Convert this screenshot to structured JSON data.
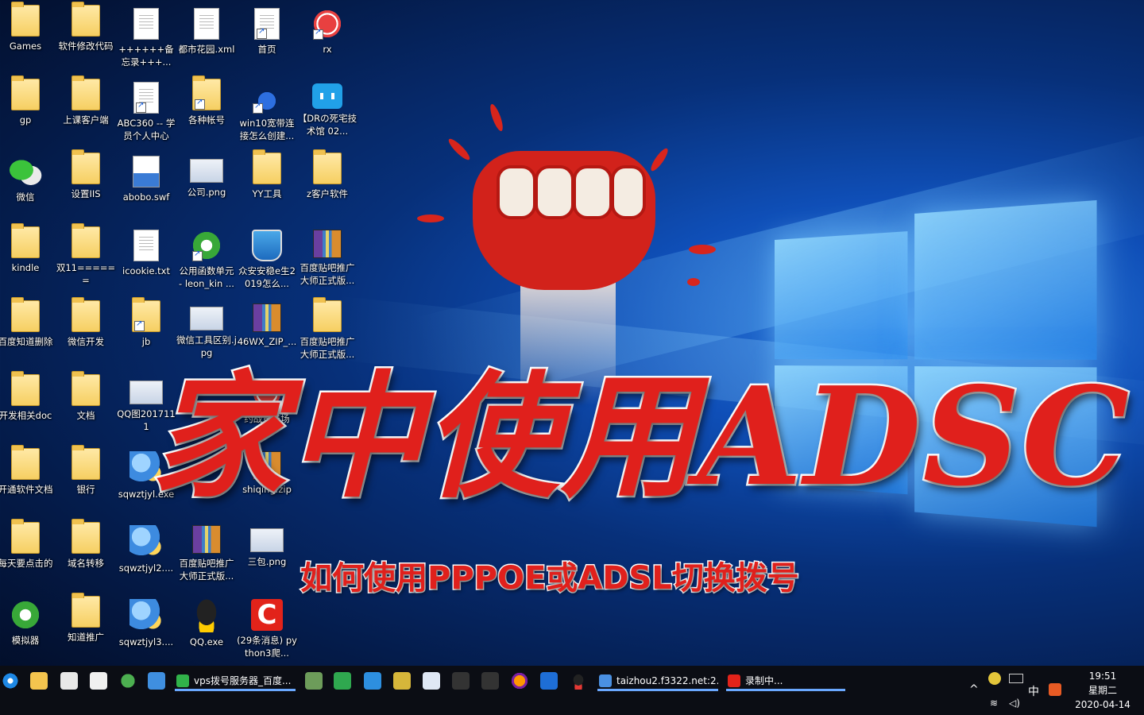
{
  "desktop": {
    "icons": [
      {
        "label": "Games"
      },
      {
        "label": "软件修改代码"
      },
      {
        "label": "++++++备忘录+++..."
      },
      {
        "label": "都市花园.xml"
      },
      {
        "label": "首页"
      },
      {
        "label": "rx"
      },
      {
        "label": "gp"
      },
      {
        "label": "上课客户端"
      },
      {
        "label": "ABC360 -- 学员个人中心"
      },
      {
        "label": "各种帐号"
      },
      {
        "label": "win10宽带连接怎么创建..."
      },
      {
        "label": "【DRの死宅技术馆 02..."
      },
      {
        "label": "微信"
      },
      {
        "label": "设置IIS"
      },
      {
        "label": "abobo.swf"
      },
      {
        "label": "公司.png"
      },
      {
        "label": "YY工具"
      },
      {
        "label": "z客户软件"
      },
      {
        "label": "kindle"
      },
      {
        "label": "双11======"
      },
      {
        "label": "icookie.txt"
      },
      {
        "label": "公用函数单元 - leon_kin ..."
      },
      {
        "label": "众安安稳e生2019怎么..."
      },
      {
        "label": "百度贴吧推广大师正式版..."
      },
      {
        "label": "百度知道删除"
      },
      {
        "label": "微信开发"
      },
      {
        "label": "jb"
      },
      {
        "label": "微信工具区别.jpg"
      },
      {
        "label": "46WX_ZIP_..."
      },
      {
        "label": "百度贴吧推广大师正式版..."
      },
      {
        "label": "开发相关doc"
      },
      {
        "label": "文档"
      },
      {
        "label": "QQ图2017111"
      },
      {
        "label": "约战竞技场"
      },
      {
        "label": "开通软件文档"
      },
      {
        "label": "银行"
      },
      {
        "label": "sqwztjyl.exe"
      },
      {
        "label": "shiqing.zip"
      },
      {
        "label": "每天要点击的"
      },
      {
        "label": "域名转移"
      },
      {
        "label": "sqwztjyl2...."
      },
      {
        "label": "百度贴吧推广大师正式版..."
      },
      {
        "label": "三包.png"
      },
      {
        "label": "模拟器"
      },
      {
        "label": "知道推广"
      },
      {
        "label": "sqwztjyl3...."
      },
      {
        "label": "QQ.exe"
      },
      {
        "label": "(29条消息) python3爬..."
      }
    ]
  },
  "overlay": {
    "title": "家中使用ADSC",
    "subtitle": "如何使用PPPOE或ADSL切换拨号"
  },
  "taskbar": {
    "tasks": [
      {
        "label": "vps拨号服务器_百度..."
      },
      {
        "label": "taizhou2.f3322.net:2..."
      },
      {
        "label": "录制中..."
      }
    ],
    "ime": "中",
    "clock": {
      "time": "19:51",
      "weekday": "星期二",
      "date": "2020-04-14"
    }
  },
  "colors": {
    "title_red": "#e0201c",
    "taskbar": "#0b0d14",
    "task_underline": "#6aa8ff"
  }
}
